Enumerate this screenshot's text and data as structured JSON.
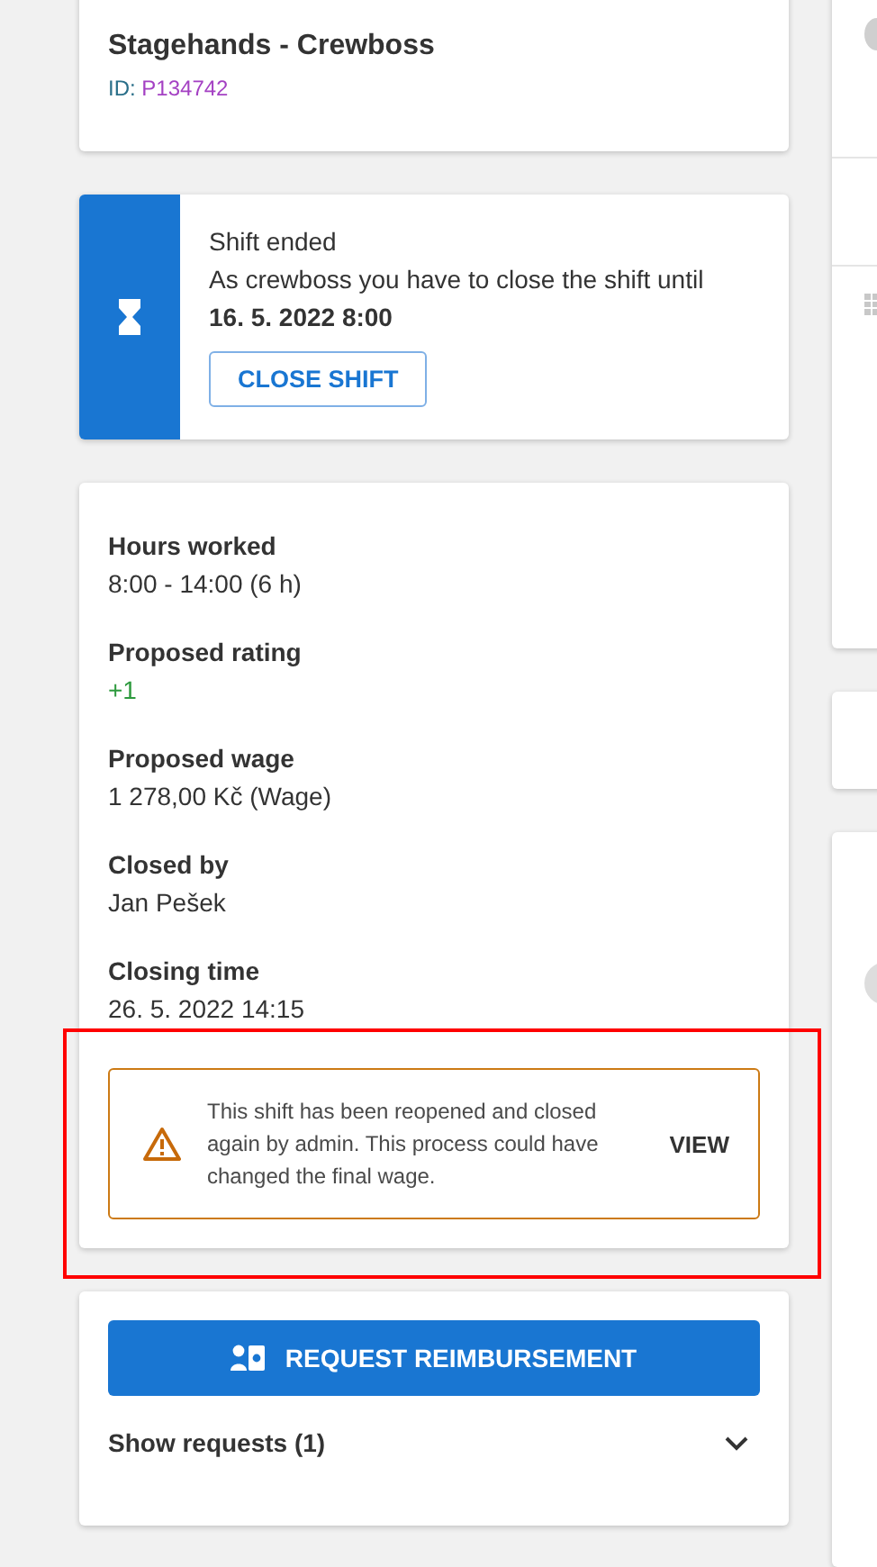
{
  "position": {
    "title": "Stagehands - Crewboss",
    "id_label": "ID:",
    "id_value": "P134742"
  },
  "shift_notice": {
    "title": "Shift ended",
    "message": "As crewboss you have to close the shift until",
    "deadline": "16. 5. 2022 8:00",
    "button": "CLOSE SHIFT"
  },
  "details": [
    {
      "label": "Hours worked",
      "value": "8:00 - 14:00 (6 h)",
      "kind": "plain"
    },
    {
      "label": "Proposed rating",
      "value": "+1",
      "kind": "positive"
    },
    {
      "label": "Proposed wage",
      "value": "1 278,00 Kč (Wage)",
      "kind": "plain"
    },
    {
      "label": "Closed by",
      "value": "Jan Pešek",
      "kind": "plain"
    },
    {
      "label": "Closing time",
      "value": "26. 5. 2022 14:15",
      "kind": "plain"
    }
  ],
  "warning": {
    "message": "This shift has been reopened and closed again by admin. This process could have changed the final wage.",
    "action": "VIEW",
    "highlighted": true
  },
  "reimbursement": {
    "button": "REQUEST REIMBURSEMENT",
    "toggle": "Show requests (1)",
    "expanded": false
  }
}
